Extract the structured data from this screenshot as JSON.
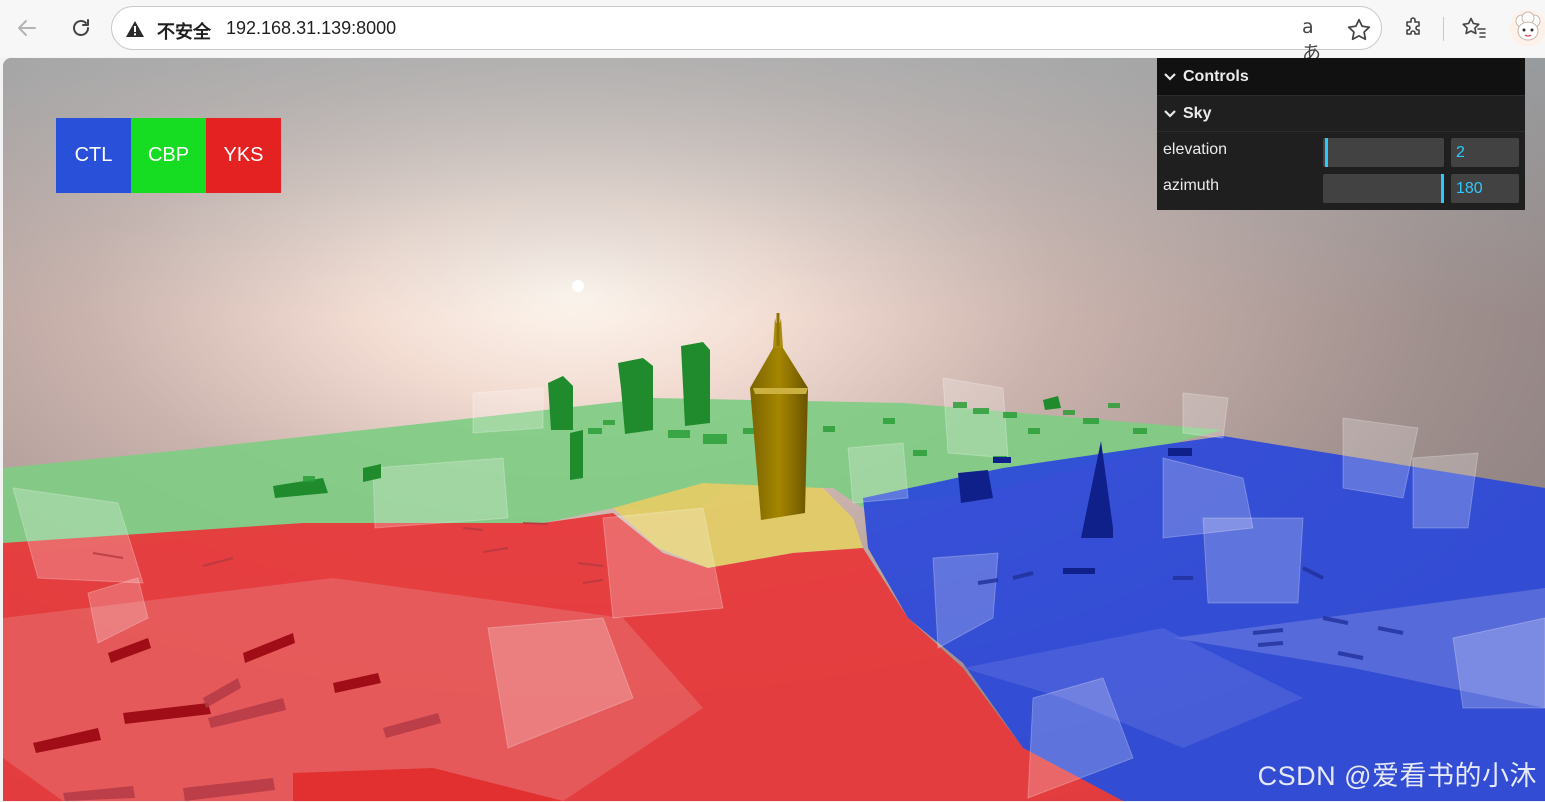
{
  "browser": {
    "security_label": "不安全",
    "url": "192.168.31.139:8000",
    "translate_glyph": "aあ"
  },
  "regions": [
    {
      "label": "CTL",
      "color": "#2950d8"
    },
    {
      "label": "CBP",
      "color": "#16dd21"
    },
    {
      "label": "YKS",
      "color": "#e42222"
    }
  ],
  "gui": {
    "title": "Controls",
    "folder": "Sky",
    "controls": [
      {
        "label": "elevation",
        "value": "2",
        "fraction": 0.02
      },
      {
        "label": "azimuth",
        "value": "180",
        "fraction": 1.0
      }
    ]
  },
  "watermark": "CSDN @爱看书的小沐"
}
